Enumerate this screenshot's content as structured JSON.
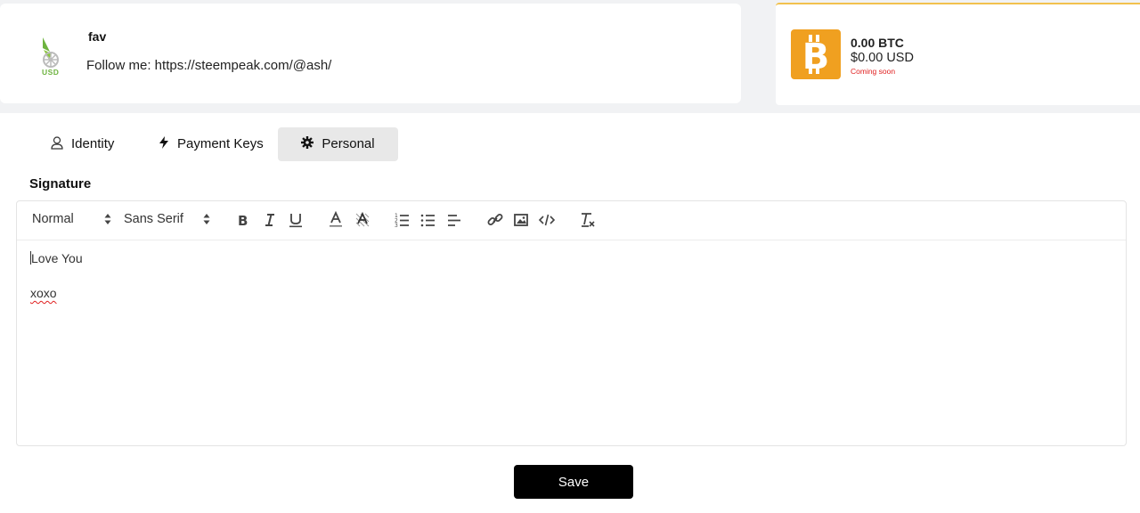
{
  "profile": {
    "logo_label": "USD",
    "name": "fav",
    "bio": "Follow me: https://steempeak.com/@ash/"
  },
  "wallet": {
    "btc_amount": "0.00 BTC",
    "usd_amount": "$0.00 USD",
    "status": "Coming soon",
    "icon": "bitcoin-icon",
    "accent_color": "#f0a020",
    "status_color": "#e02020"
  },
  "tabs": [
    {
      "label": "Identity",
      "icon": "user-icon",
      "active": false
    },
    {
      "label": "Payment Keys",
      "icon": "lightning-icon",
      "active": false
    },
    {
      "label": "Personal",
      "icon": "gear-icon",
      "active": true
    }
  ],
  "signature": {
    "label": "Signature",
    "toolbar": {
      "size_select": "Normal",
      "font_select": "Sans Serif",
      "buttons": [
        "bold-icon",
        "italic-icon",
        "underline-icon",
        "font-color-icon",
        "background-color-icon",
        "ordered-list-icon",
        "bullet-list-icon",
        "align-icon",
        "link-icon",
        "image-icon",
        "code-icon",
        "clear-format-icon"
      ]
    },
    "lines": [
      "Love You",
      "xoxo"
    ]
  },
  "save_label": "Save"
}
